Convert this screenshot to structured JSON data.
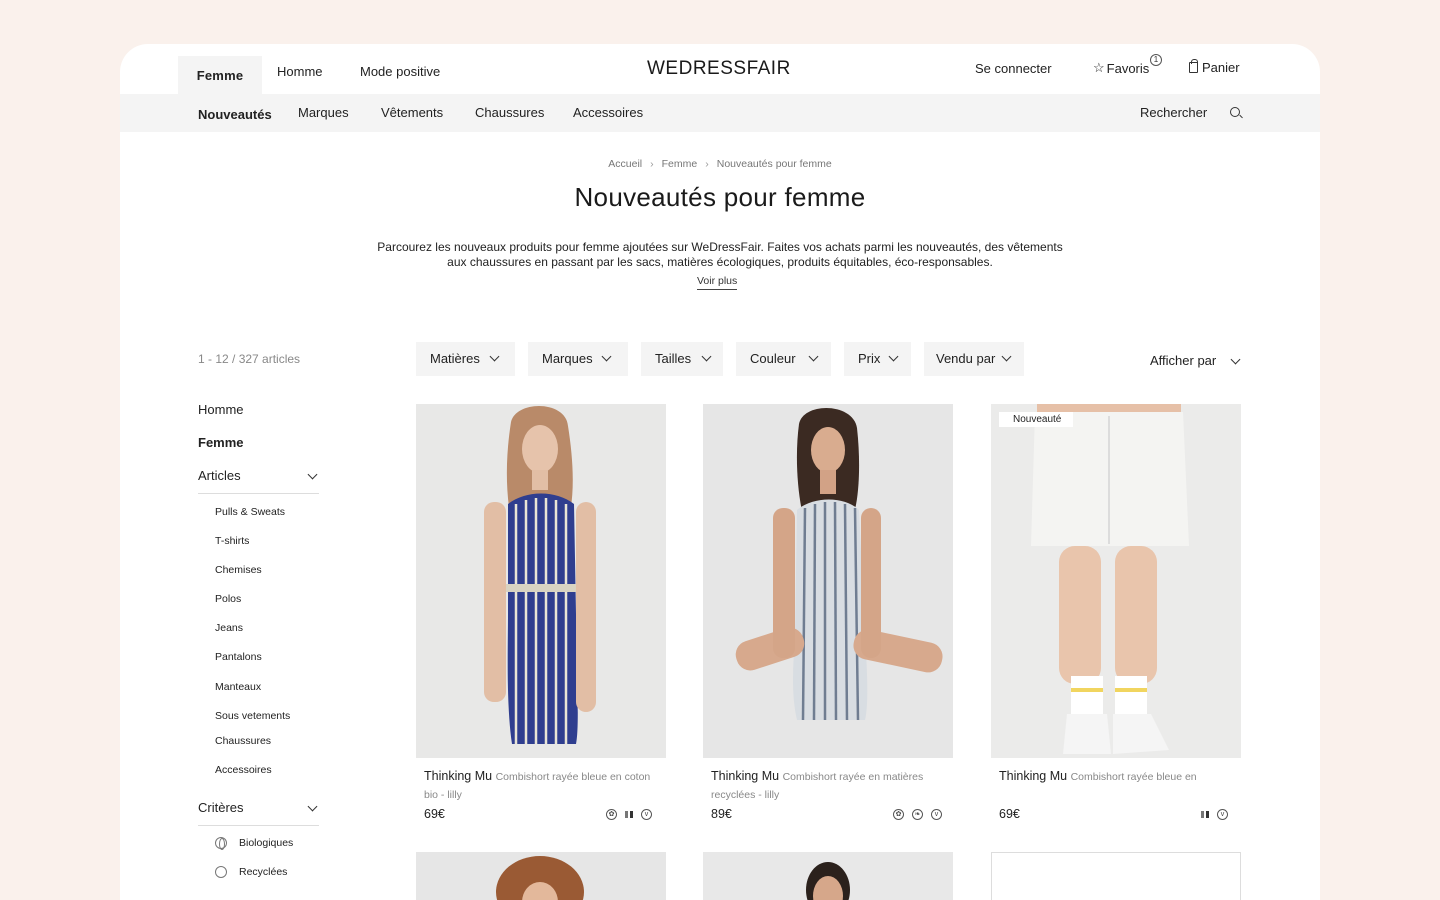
{
  "header": {
    "tabs": [
      "Femme",
      "Homme",
      "Mode positive"
    ],
    "logo_light": "WE",
    "logo_bold": "DRESS",
    "logo_end": "FAIR",
    "login": "Se connecter",
    "favorites": "Favoris",
    "favorites_count": "1",
    "cart": "Panier"
  },
  "subnav": {
    "items": [
      "Nouveautés",
      "Marques",
      "Vêtements",
      "Chaussures",
      "Accessoires"
    ],
    "search": "Rechercher"
  },
  "page": {
    "breadcrumb": [
      "Accueil",
      "Femme",
      "Nouveautés pour femme"
    ],
    "title": "Nouveautés pour femme",
    "description": "Parcourez les nouveaux produits pour femme ajoutées sur WeDressFair. Faites vos achats parmi les nouveautés, des vêtements aux chaussures en passant par les sacs, matières écologiques, produits équitables, éco-responsables.",
    "more": "Voir plus"
  },
  "sidebar": {
    "count": "1 - 12 / 327 articles",
    "top": [
      "Homme",
      "Femme"
    ],
    "articles_label": "Articles",
    "articles": [
      "Pulls & Sweats",
      "T-shirts",
      "Chemises",
      "Polos",
      "Jeans",
      "Pantalons",
      "Manteaux",
      "Sous vetements",
      "Chaussures",
      "Accessoires"
    ],
    "criteria_label": "Critères",
    "criteria": [
      "Biologiques",
      "Recyclées"
    ]
  },
  "filters": [
    "Matières",
    "Marques",
    "Tailles",
    "Couleur",
    "Prix",
    "Vendu par"
  ],
  "sort": "Afficher par",
  "products": [
    {
      "brand": "Thinking Mu",
      "desc": "Combishort rayée bleue en coton bio - lilly",
      "price": "69€"
    },
    {
      "brand": "Thinking Mu",
      "desc": "Combishort rayée en matières recyclées - lilly",
      "price": "89€"
    },
    {
      "brand": "Thinking Mu",
      "desc": "Combishort rayée bleue en",
      "price": "69€",
      "tag": "Nouveauté"
    }
  ],
  "colors": {
    "page_bg": "#faf1ec",
    "band": "#f4f4f4",
    "text": "#1f1f1f",
    "muted": "#888888"
  }
}
